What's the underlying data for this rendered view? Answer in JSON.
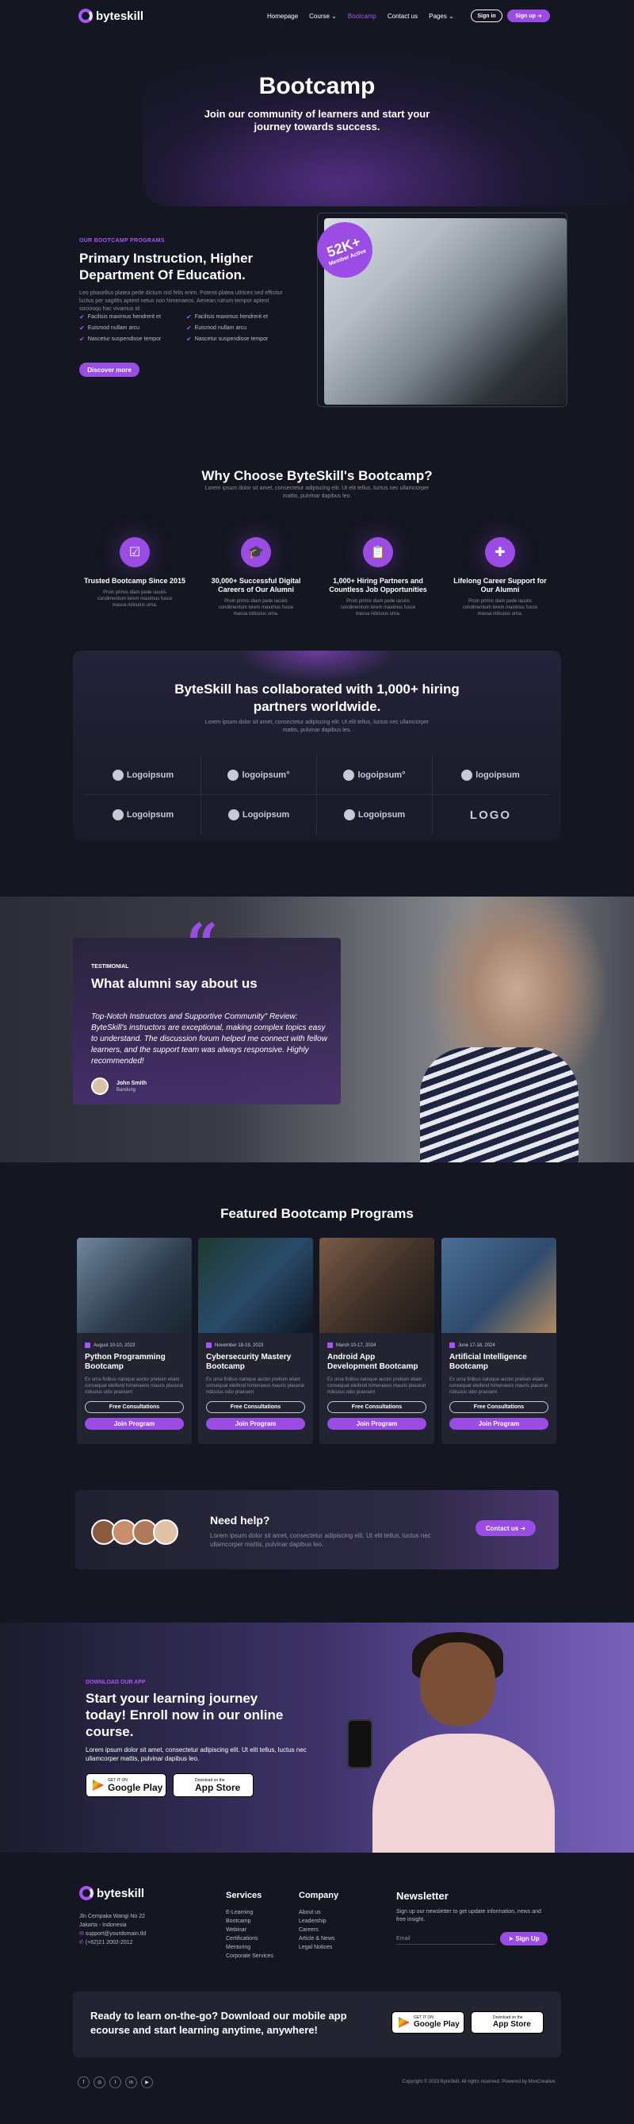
{
  "brand": {
    "name": "byteskill",
    "accent": "#9b4ce5"
  },
  "nav": {
    "items": [
      "Homepage",
      "Course ⌄",
      "Bootcamp",
      "Contact us",
      "Pages ⌄"
    ],
    "active": "Bootcamp",
    "sign_in": "Sign in",
    "sign_up": "Sign up ➜"
  },
  "hero": {
    "title": "Bootcamp",
    "subtitle": "Join our community of learners and start your journey towards success."
  },
  "instruction": {
    "eyebrow": "OUR BOOTCAMP PROGRAMS",
    "title": "Primary Instruction, Higher Department Of Education.",
    "desc": "Leo phasellus platea pede dictum nisl felis enim. Potenti platea ultrices sed efficitur luctus per sagittis aptent netus non himenaeos. Aenean rutrum tempor aptent sociosqu hac vivamus id.",
    "checks": [
      "Facilisis maximus hendrerit et",
      "Facilisis maximus hendrerit et",
      "Euismod nullam arcu",
      "Euismod nullam arcu",
      "Nascetur suspendisse tempor",
      "Nascetur suspendisse tempor"
    ],
    "button": "Discover more",
    "badge_big": "52K+",
    "badge_small": "Member Active"
  },
  "why": {
    "title": "Why Choose ByteSkill's Bootcamp?",
    "subtitle": "Lorem ipsum dolor sit amet, consectetur adipiscing elit. Ut elit tellus, luctus nec ullamcorper mattis, pulvinar dapibus leo.",
    "features": [
      {
        "icon": "certificate-icon",
        "title": "Trusted Bootcamp Since 2015",
        "desc": "Proin primis diam pede iaculis condimentum lorem maximus fusce massa ridiculus urna."
      },
      {
        "icon": "graduation-cap-icon",
        "title": "30,000+ Successful Digital Careers of Our Alumni",
        "desc": "Proin primis diam pede iaculis condimentum lorem maximus fusce massa ridiculus urna."
      },
      {
        "icon": "clipboard-check-icon",
        "title": "1,000+ Hiring Partners and Countless Job Opportunities",
        "desc": "Proin primis diam pede iaculis condimentum lorem maximus fusce massa ridiculus urna."
      },
      {
        "icon": "chat-support-icon",
        "title": "Lifelong Career Support for Our Alumni",
        "desc": "Proin primis diam pede iaculis condimentum lorem maximus fusce massa ridiculus urna."
      }
    ]
  },
  "partners": {
    "title": "ByteSkill has collaborated with 1,000+ hiring partners worldwide.",
    "subtitle": "Lorem ipsum dolor sit amet, consectetur adipiscing elit. Ut elit tellus, luctus nec ullamcorper mattis, pulvinar dapibus leo.",
    "logos": [
      "Logoipsum",
      "logoipsum°",
      "logoipsum°",
      "logoipsum",
      "Logoipsum",
      "Logoipsum",
      "Logoipsum",
      "LOGO"
    ]
  },
  "testimonial": {
    "quote_mark": "“",
    "eyebrow": "TESTIMONIAL",
    "title": "What alumni say about us",
    "text": "Top-Notch Instructors and Supportive Community\" Review: ByteSkill's instructors are exceptional, making complex topics easy to understand. The discussion forum helped me connect with fellow learners, and the support team was always responsive. Highly recommended!",
    "author": "John Smith",
    "city": "Bandung"
  },
  "featured": {
    "title": "Featured Bootcamp Programs",
    "courses": [
      {
        "date": "August 10-10, 2023",
        "title": "Python Programming Bootcamp",
        "desc": "Ex urna finibus natoque auctor pretium etiam consequat eleifend himenaeos mauris placerat ridiculus odio praesent",
        "consult": "Free Consultations",
        "join": "Join Program"
      },
      {
        "date": "November 18-19, 2023",
        "title": "Cybersecurity Mastery Bootcamp",
        "desc": "Ex urna finibus natoque auctor pretium etiam consequat eleifend himenaeos mauris placerat ridiculus odio praesent",
        "consult": "Free Consultations",
        "join": "Join Program"
      },
      {
        "date": "March 10-17, 2024",
        "title": "Android App Development Bootcamp",
        "desc": "Ex urna finibus natoque auctor pretium etiam consequat eleifend himenaeos mauris placerat ridiculus odio praesent",
        "consult": "Free Consultations",
        "join": "Join Program"
      },
      {
        "date": "June 17-18, 2024",
        "title": "Artificial Intelligence Bootcamp",
        "desc": "Ex urna finibus natoque auctor pretium etiam consequat eleifend himenaeos mauris placerat ridiculus odio praesent",
        "consult": "Free Consultations",
        "join": "Join Program"
      }
    ]
  },
  "help": {
    "title": "Need help?",
    "desc": "Lorem ipsum dolor sit amet, consectetur adipiscing elit. Ut elit tellus, luctus nec ullamcorper mattis, pulvinar dapibus leo.",
    "button": "Contact us ➜"
  },
  "app": {
    "eyebrow": "DOWNLOAD OUR APP",
    "title": "Start your learning journey today! Enroll now in our online course.",
    "desc": "Lorem ipsum dolor sit amet, consectetur adipiscing elit. Ut elit tellus, luctus nec ullamcorper mattis, pulvinar dapibus leo.",
    "google_small": "GET IT ON",
    "google_big": "Google Play",
    "apple_small": "Download on the",
    "apple_big": "App Store"
  },
  "footer": {
    "address1": "Jln Cempaka Wangi No 22",
    "address2": "Jakarta - Indonesia",
    "email": "support@yourdomain.tld",
    "phone": "(+62)21 2002-2012",
    "services_title": "Services",
    "services": [
      "E-Learning",
      "Bootcamp",
      "Webinar",
      "Certifications",
      "Mentoring",
      "Corporate Services"
    ],
    "company_title": "Company",
    "company": [
      "About us",
      "Leadership",
      "Careers",
      "Article & News",
      "Legal Notices"
    ],
    "newsletter_title": "Newsletter",
    "newsletter_desc": "Sign up our newsletter to get update information, news and free insight.",
    "email_placeholder": "Email",
    "signup": "Sign Up",
    "download_title": "Ready to learn on-the-go? Download our mobile app ecourse and start learning anytime, anywhere!",
    "social": [
      "f",
      "◎",
      "t",
      "in",
      "▶"
    ],
    "copyright": "Copyright © 2023 ByteSkill. All rights reserved. Powered by MoxCreative."
  }
}
